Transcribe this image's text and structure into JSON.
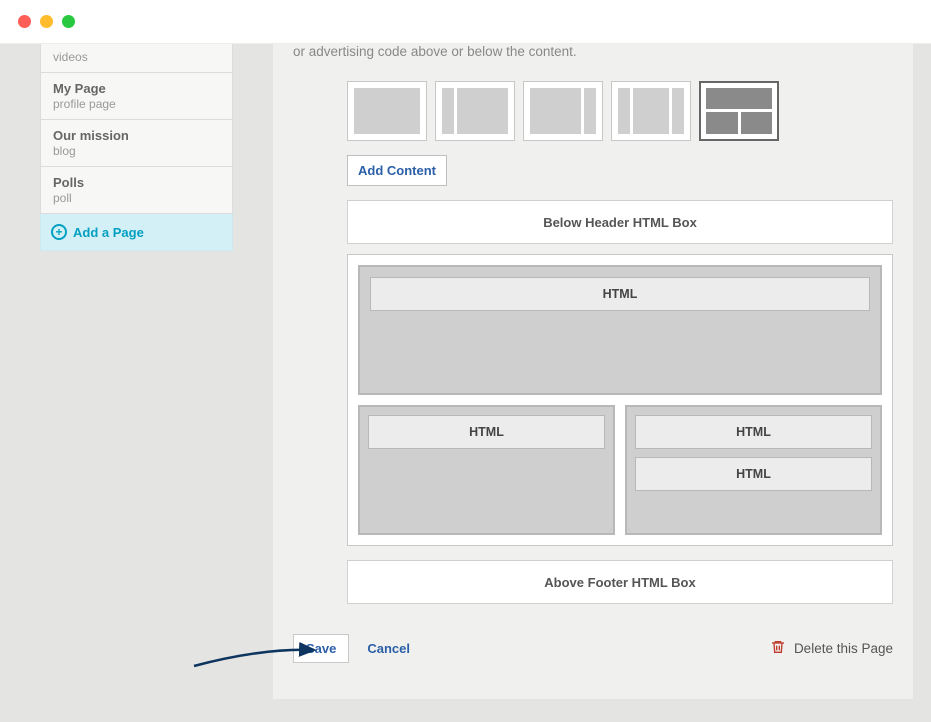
{
  "description_partial": "or advertising code above or below the content.",
  "sidebar": {
    "items": [
      {
        "title": "",
        "sub": "videos"
      },
      {
        "title": "My Page",
        "sub": "profile page"
      },
      {
        "title": "Our mission",
        "sub": "blog"
      },
      {
        "title": "Polls",
        "sub": "poll"
      }
    ],
    "add_page_label": "Add a Page"
  },
  "actions": {
    "add_content_label": "Add Content",
    "save_label": "Save",
    "cancel_label": "Cancel",
    "delete_label": "Delete this Page"
  },
  "boxes": {
    "below_header": "Below Header HTML Box",
    "above_footer": "Above Footer HTML Box",
    "html_chip": "HTML"
  },
  "layout": {
    "selected_index": 4
  }
}
